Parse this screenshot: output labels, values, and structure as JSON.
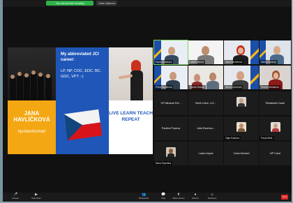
{
  "topbar": {
    "share_label": "You are screen sharing",
    "view_label": "View Options"
  },
  "slide": {
    "name": "JANA HAVLÍČKOVÁ",
    "hashtag": "#justworksmart",
    "heading": "My abbreviated JCI career:",
    "career": "LP, NP, COC, EDC, BC, GDC, VPT :-)",
    "motto": "LIVE LEARN TEACH REPEAT"
  },
  "gallery": {
    "video_tiles": [
      {
        "label": "Hana Horáková"
      },
      {
        "label": "Lukáš Zlámal"
      },
      {
        "label": "Jana Havlíčková"
      },
      {
        "label": "Michal Soukup"
      },
      {
        "label": "Petra Nováková"
      },
      {
        "label": "Tomáš Brázda"
      },
      {
        "label": "Alena Kučerová"
      },
      {
        "label": "Tereza Hanáková"
      }
    ],
    "name_tiles": [
      {
        "name": "VP Mihaela Pet..."
      },
      {
        "name": "Heidi Lökre, LIC..."
      },
      {
        "name": ""
      },
      {
        "name": "Elisabetta Casel"
      },
      {
        "name": "Paulina Popova"
      },
      {
        "name": "Julia Rasmus..."
      },
      {
        "name": ""
      },
      {
        "name": ""
      },
      {
        "name": ""
      },
      {
        "name": "Laska Kapia"
      },
      {
        "name": "Carla Monard"
      },
      {
        "name": "NP Carol"
      }
    ],
    "avatar_tiles": [
      {
        "label": "Nana Gyamfua"
      },
      {
        "label": "Olga Kostova"
      },
      {
        "label": "Paola Mele"
      }
    ]
  },
  "toolbar": {
    "items": [
      {
        "icon": "mic-icon",
        "glyph": "🎤",
        "label": "Unmute"
      },
      {
        "icon": "camera-icon",
        "glyph": "▶",
        "label": "Stop Video"
      },
      {
        "icon": "participants-icon",
        "glyph": "👥",
        "label": "Participants"
      },
      {
        "icon": "chat-icon",
        "glyph": "💬",
        "label": "Chat"
      },
      {
        "icon": "share-icon",
        "glyph": "⬆",
        "label": "Share Screen"
      },
      {
        "icon": "record-icon",
        "glyph": "●",
        "label": "Record"
      },
      {
        "icon": "reactions-icon",
        "glyph": "☺",
        "label": "Reactions"
      }
    ],
    "end_label": "End"
  },
  "colors": {
    "jci_blue": "#1f56b8",
    "jci_yellow": "#f3a712",
    "active_speaker": "#7ad35d",
    "end_red": "#e02828"
  }
}
